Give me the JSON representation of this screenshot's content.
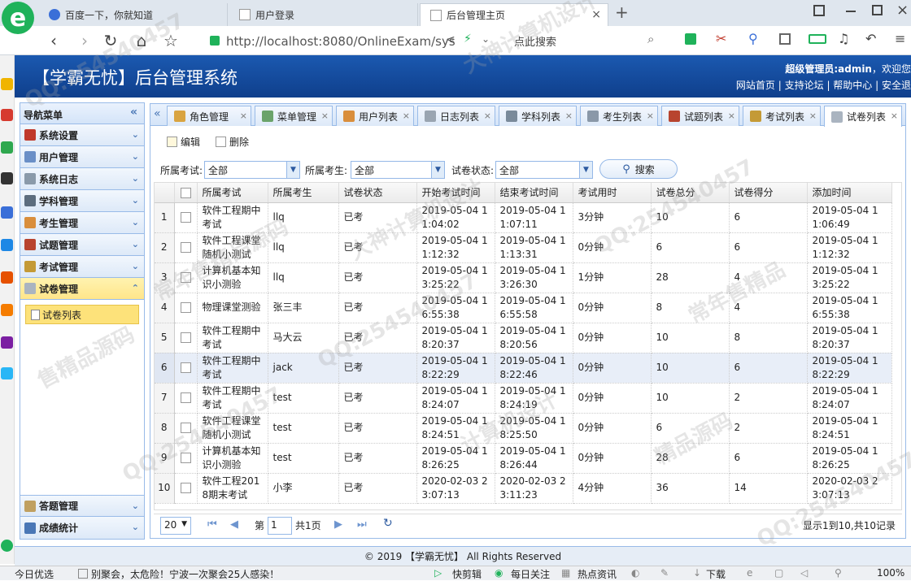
{
  "browser": {
    "tabs": [
      {
        "title": "百度一下，你就知道"
      },
      {
        "title": "用户登录"
      },
      {
        "title": "后台管理主页"
      }
    ],
    "url": "http://localhost:8080/OnlineExam/sys",
    "search_hint": "点此搜索",
    "new_tab": "+",
    "close": "×"
  },
  "app": {
    "title": "【学霸无忧】后台管理系统",
    "user_label": "超级管理员:admin",
    "welcome": "，欢迎您",
    "links": [
      "网站首页",
      "支持论坛",
      "帮助中心",
      "安全退"
    ],
    "footer": "© 2019 【学霸无忧】 All Rights Reserved"
  },
  "nav": {
    "header": "导航菜单",
    "items": [
      {
        "label": "系统设置",
        "color": "#c0392b"
      },
      {
        "label": "用户管理",
        "color": "#6a8fc7"
      },
      {
        "label": "系统日志",
        "color": "#8a9aaa"
      },
      {
        "label": "学科管理",
        "color": "#5d6d7e"
      },
      {
        "label": "考生管理",
        "color": "#d98e3c"
      },
      {
        "label": "试题管理",
        "color": "#b8442f"
      },
      {
        "label": "考试管理",
        "color": "#c49a36"
      },
      {
        "label": "试卷管理",
        "color": "#aab4c0"
      }
    ],
    "sub_item": "试卷列表",
    "bottom_items": [
      {
        "label": "答题管理",
        "color": "#c0a060"
      },
      {
        "label": "成绩统计",
        "color": "#4a77b6"
      }
    ]
  },
  "tabs": [
    {
      "label": "角色管理",
      "color": "#d9a441"
    },
    {
      "label": "菜单管理",
      "color": "#6aa36a"
    },
    {
      "label": "用户列表",
      "color": "#d98e3c"
    },
    {
      "label": "日志列表",
      "color": "#9aa5b1"
    },
    {
      "label": "学科列表",
      "color": "#7a8a9a"
    },
    {
      "label": "考生列表",
      "color": "#8a98a8"
    },
    {
      "label": "试题列表",
      "color": "#b8442f"
    },
    {
      "label": "考试列表",
      "color": "#c49a36"
    },
    {
      "label": "试卷列表",
      "color": "#aab4c0"
    }
  ],
  "toolbar": {
    "edit": "编辑",
    "delete": "删除"
  },
  "filters": {
    "exam_label": "所属考试:",
    "exam_value": "全部",
    "student_label": "所属考生:",
    "student_value": "全部",
    "status_label": "试卷状态:",
    "status_value": "全部",
    "search": "搜索"
  },
  "table": {
    "columns": [
      "所属考试",
      "所属考生",
      "试卷状态",
      "开始考试时间",
      "结束考试时间",
      "考试用时",
      "试卷总分",
      "试卷得分",
      "添加时间"
    ],
    "rows": [
      {
        "n": "1",
        "exam": "软件工程期中考试",
        "student": "llq",
        "status": "已考",
        "start": "2019-05-04 11:04:02",
        "end": "2019-05-04 11:07:11",
        "used": "3分钟",
        "total": "10",
        "score": "6",
        "added": "2019-05-04 11:06:49"
      },
      {
        "n": "2",
        "exam": "软件工程课堂随机小测试",
        "student": "llq",
        "status": "已考",
        "start": "2019-05-04 11:12:32",
        "end": "2019-05-04 11:13:31",
        "used": "0分钟",
        "total": "6",
        "score": "6",
        "added": "2019-05-04 11:12:32"
      },
      {
        "n": "3",
        "exam": "计算机基本知识小测验",
        "student": "llq",
        "status": "已考",
        "start": "2019-05-04 13:25:22",
        "end": "2019-05-04 13:26:30",
        "used": "1分钟",
        "total": "28",
        "score": "4",
        "added": "2019-05-04 13:25:22"
      },
      {
        "n": "4",
        "exam": "物理课堂测验",
        "student": "张三丰",
        "status": "已考",
        "start": "2019-05-04 16:55:38",
        "end": "2019-05-04 16:55:58",
        "used": "0分钟",
        "total": "8",
        "score": "4",
        "added": "2019-05-04 16:55:38"
      },
      {
        "n": "5",
        "exam": "软件工程期中考试",
        "student": "马大云",
        "status": "已考",
        "start": "2019-05-04 18:20:37",
        "end": "2019-05-04 18:20:56",
        "used": "0分钟",
        "total": "10",
        "score": "8",
        "added": "2019-05-04 18:20:37"
      },
      {
        "n": "6",
        "exam": "软件工程期中考试",
        "student": "jack",
        "status": "已考",
        "start": "2019-05-04 18:22:29",
        "end": "2019-05-04 18:22:46",
        "used": "0分钟",
        "total": "10",
        "score": "6",
        "added": "2019-05-04 18:22:29"
      },
      {
        "n": "7",
        "exam": "软件工程期中考试",
        "student": "test",
        "status": "已考",
        "start": "2019-05-04 18:24:07",
        "end": "2019-05-04 18:24:19",
        "used": "0分钟",
        "total": "10",
        "score": "2",
        "added": "2019-05-04 18:24:07"
      },
      {
        "n": "8",
        "exam": "软件工程课堂随机小测试",
        "student": "test",
        "status": "已考",
        "start": "2019-05-04 18:24:51",
        "end": "2019-05-04 18:25:50",
        "used": "0分钟",
        "total": "6",
        "score": "2",
        "added": "2019-05-04 18:24:51"
      },
      {
        "n": "9",
        "exam": "计算机基本知识小测验",
        "student": "test",
        "status": "已考",
        "start": "2019-05-04 18:26:25",
        "end": "2019-05-04 18:26:44",
        "used": "0分钟",
        "total": "28",
        "score": "6",
        "added": "2019-05-04 18:26:25"
      },
      {
        "n": "10",
        "exam": "软件工程2018期末考试",
        "student": "小李",
        "status": "已考",
        "start": "2020-02-03 23:07:13",
        "end": "2020-02-03 23:11:23",
        "used": "4分钟",
        "total": "36",
        "score": "14",
        "added": "2020-02-03 23:07:13"
      }
    ],
    "highlight_row": 6
  },
  "pager": {
    "page_size": "20",
    "page_prefix": "第",
    "page": "1",
    "page_suffix": "共1页",
    "summary": "显示1到10,共10记录"
  },
  "statusbar": {
    "left": "今日优选",
    "news": "别聚会，太危险！宁波一次聚会25人感染！",
    "items": [
      "快剪辑",
      "每日关注",
      "热点资讯",
      "下载"
    ],
    "zoom": "100%"
  },
  "watermarks": [
    "QQ:254540457",
    "大神计算机设计",
    "常年售精品源码",
    "QQ:254540457",
    "售精品源码",
    "大神计算机设计",
    "QQ:254540457",
    "常年售精品",
    "QQ:254540457",
    "精品源码",
    "计算机设计",
    "QQ:254540457"
  ]
}
